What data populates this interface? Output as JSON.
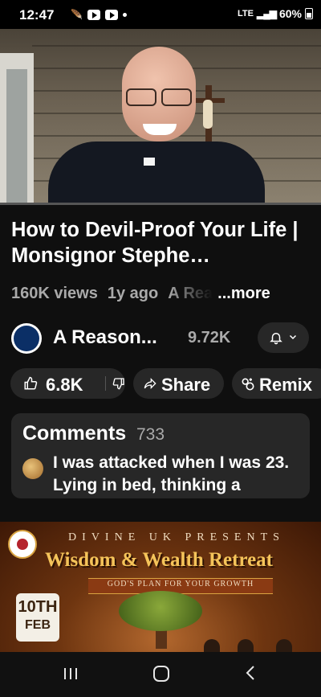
{
  "status_bar": {
    "time": "12:47",
    "network": "LTE",
    "battery": "60%"
  },
  "video": {
    "title": "How to Devil-Proof Your Life | Monsignor Stephe…"
  },
  "meta": {
    "views": "160K views",
    "age": "1y ago",
    "channel_preview": "A Rea",
    "more": "...more"
  },
  "channel": {
    "name": "A Reason...",
    "subscribers": "9.72K"
  },
  "actions": {
    "likes": "6.8K",
    "share": "Share",
    "remix": "Remix"
  },
  "comments": {
    "title": "Comments",
    "count": "733",
    "top_comment": "I was attacked when I was 23. Lying in bed, thinking a"
  },
  "ad": {
    "presenter": "DIVINE UK PRESENTS",
    "headline": "Wisdom & Wealth Retreat",
    "subtitle": "GOD'S PLAN FOR YOUR GROWTH",
    "date_day": "10TH",
    "date_month": "FEB"
  },
  "icons": [
    "youtube-icon",
    "bell-icon",
    "like-icon",
    "dislike-icon",
    "share-icon",
    "remix-icon",
    "recents-icon",
    "home-icon",
    "back-icon"
  ],
  "colors": {
    "background": "#0f0f0f",
    "chip": "#272727",
    "secondary_text": "#aaaaaa",
    "ad_gold": "#f5c45a"
  }
}
